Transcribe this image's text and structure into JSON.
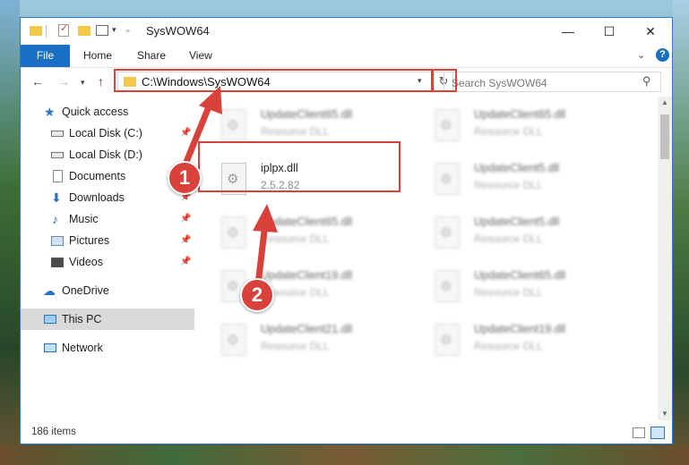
{
  "window": {
    "title": "SysWOW64",
    "controls": {
      "minimize": "—",
      "maximize": "☐",
      "close": "✕"
    }
  },
  "ribbon": {
    "tabs": [
      "File",
      "Home",
      "Share",
      "View"
    ],
    "help": "?"
  },
  "address": {
    "path": "C:\\Windows\\SysWOW64",
    "search_placeholder": "Search SysWOW64"
  },
  "sidebar": {
    "items": [
      {
        "label": "Quick access",
        "icon": "star-icon"
      },
      {
        "label": "Local Disk (C:)",
        "icon": "drive-icon",
        "pinned": true
      },
      {
        "label": "Local Disk (D:)",
        "icon": "drive-icon"
      },
      {
        "label": "Documents",
        "icon": "documents-icon",
        "pinned": true
      },
      {
        "label": "Downloads",
        "icon": "downloads-icon",
        "pinned": true
      },
      {
        "label": "Music",
        "icon": "music-icon",
        "pinned": true
      },
      {
        "label": "Pictures",
        "icon": "pictures-icon",
        "pinned": true
      },
      {
        "label": "Videos",
        "icon": "videos-icon",
        "pinned": true
      },
      {
        "label": "OneDrive",
        "icon": "onedrive-icon"
      },
      {
        "label": "This PC",
        "icon": "this-pc-icon",
        "selected": true
      },
      {
        "label": "Network",
        "icon": "network-icon"
      }
    ]
  },
  "files": {
    "selected": {
      "name": "iplpx.dll",
      "version": "2.5.2.82"
    },
    "left_column": [
      {
        "name": "UpdateClient65.dll",
        "desc": "Resource DLL"
      },
      {
        "name": "UpdateClient65.dll",
        "desc": "Resource DLL"
      },
      {
        "name": "UpdateClient19.dll",
        "desc": "Resource DLL"
      },
      {
        "name": "UpdateClient21.dll",
        "desc": "Resource DLL"
      }
    ],
    "right_column": [
      {
        "name": "UpdateClient65.dll",
        "desc": "Resource DLL"
      },
      {
        "name": "UpdateClient5.dll",
        "desc": "Resource DLL"
      },
      {
        "name": "UpdateClient5.dll",
        "desc": "Resource DLL"
      },
      {
        "name": "UpdateClient65.dll",
        "desc": "Resource DLL"
      },
      {
        "name": "UpdateClient19.dll",
        "desc": "Resource DLL"
      }
    ]
  },
  "status": {
    "item_count": "186 items"
  },
  "annotations": {
    "badge_1": "1",
    "badge_2": "2",
    "color": "#d9423a"
  }
}
